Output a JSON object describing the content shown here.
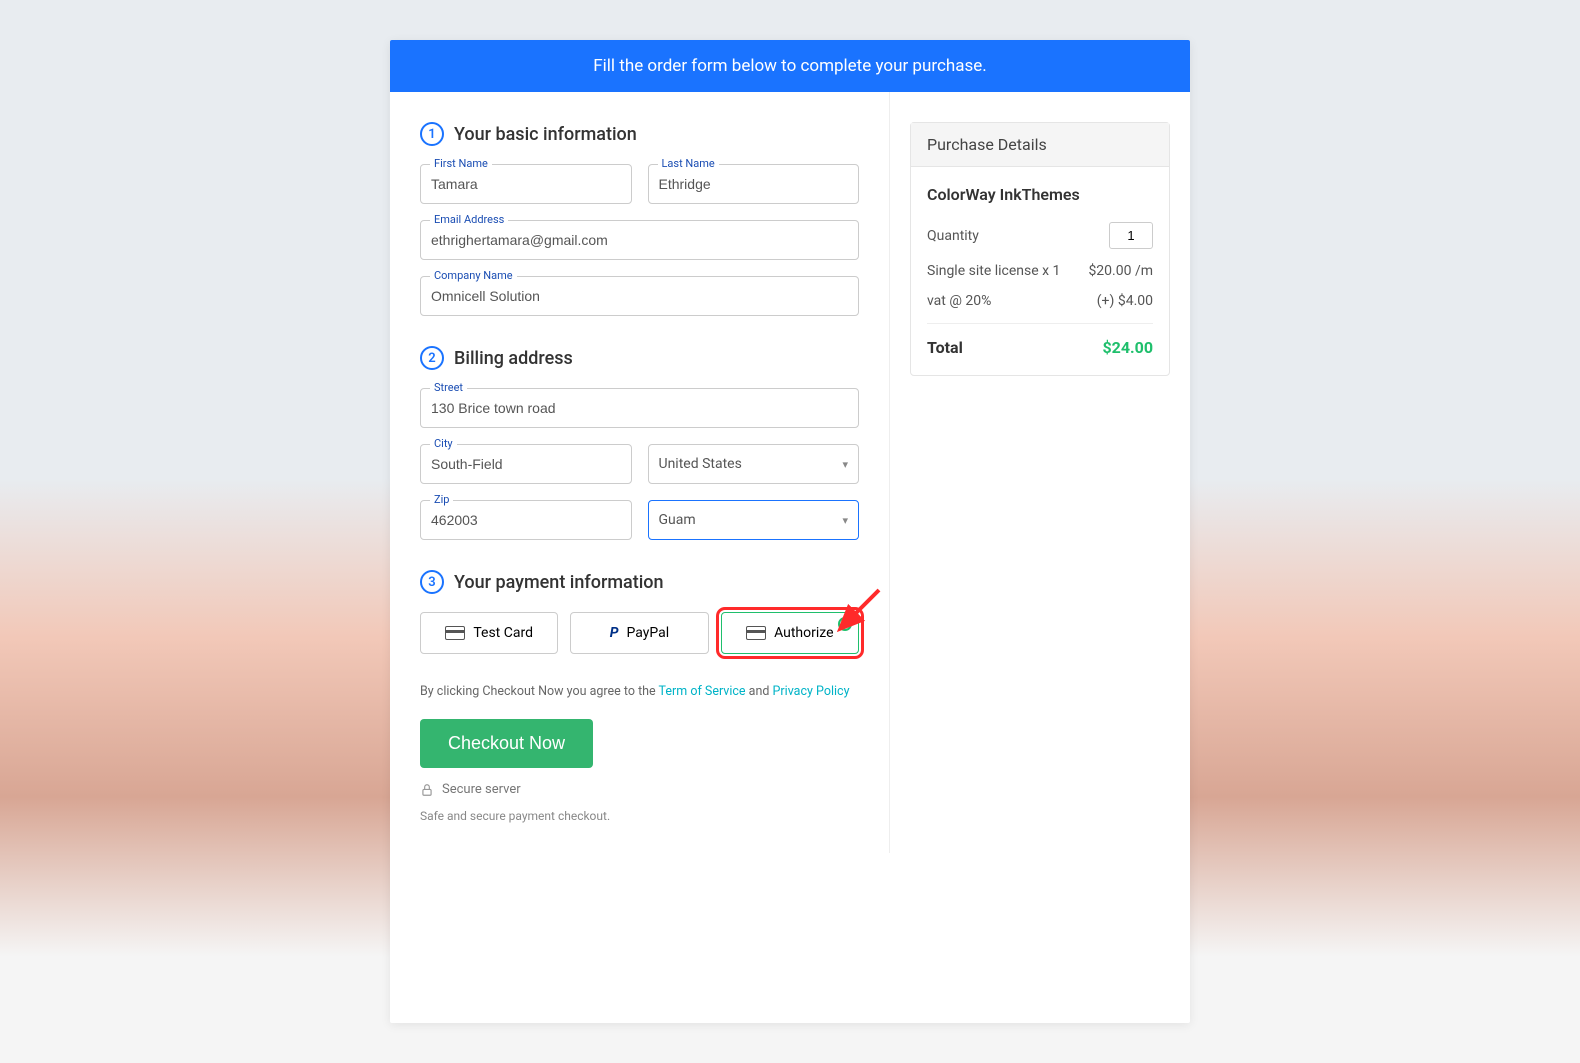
{
  "banner": "Fill the order form below to complete your purchase.",
  "sections": {
    "basic": {
      "num": "1",
      "title": "Your basic information"
    },
    "billing": {
      "num": "2",
      "title": "Billing address"
    },
    "payment": {
      "num": "3",
      "title": "Your payment information"
    }
  },
  "fields": {
    "first_name": {
      "label": "First Name",
      "value": "Tamara"
    },
    "last_name": {
      "label": "Last Name",
      "value": "Ethridge"
    },
    "email": {
      "label": "Email Address",
      "value": "ethrighertamara@gmail.com"
    },
    "company": {
      "label": "Company Name",
      "value": "Omnicell Solution"
    },
    "street": {
      "label": "Street",
      "value": "130 Brice town road"
    },
    "city": {
      "label": "City",
      "value": "South-Field"
    },
    "country": {
      "value": "United States"
    },
    "zip": {
      "label": "Zip",
      "value": "462003"
    },
    "state": {
      "value": "Guam"
    }
  },
  "payment_options": {
    "test_card": "Test Card",
    "paypal": "PayPal",
    "authorize": "Authorize"
  },
  "terms": {
    "pre": "By clicking Checkout Now you agree to the ",
    "tos": "Term of Service",
    "mid": " and ",
    "pp": "Privacy Policy"
  },
  "checkout_btn": "Checkout Now",
  "secure_server": "Secure server",
  "secure_note": "Safe and secure payment checkout.",
  "details": {
    "head": "Purchase Details",
    "product": "ColorWay InkThemes",
    "qty_label": "Quantity",
    "qty": "1",
    "line_item": "Single site license x 1",
    "line_price": "$20.00 /m",
    "vat_label": "vat @ 20%",
    "vat_price": "(+) $4.00",
    "total_label": "Total",
    "total": "$24.00"
  }
}
